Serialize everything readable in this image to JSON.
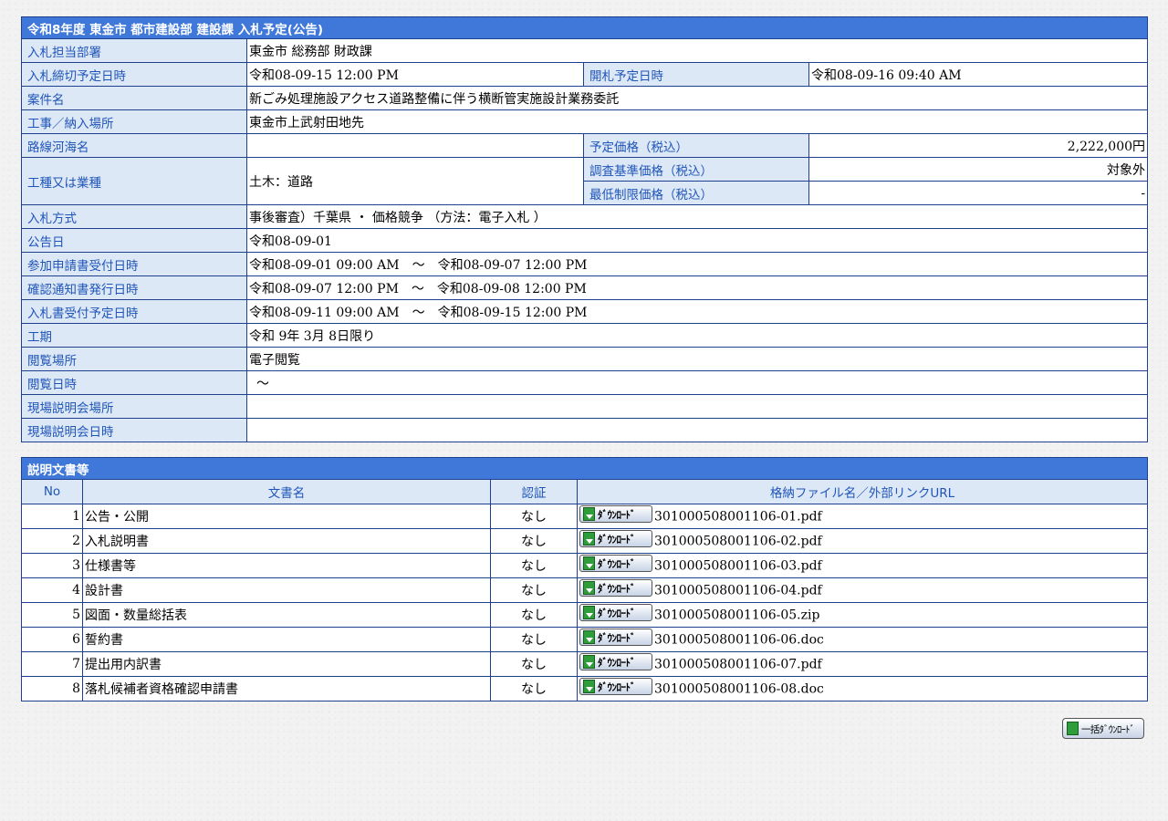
{
  "info": {
    "title": "令和8年度 東金市 都市建設部 建設課 入札予定(公告)",
    "rows": {
      "dept_label": "入札担当部署",
      "dept_value": "東金市 総務部 財政課",
      "deadline_label": "入札締切予定日時",
      "deadline_value": "令和08-09-15 12:00 PM",
      "opening_label": "開札予定日時",
      "opening_value": "令和08-09-16 09:40 AM",
      "case_label": "案件名",
      "case_value": "新ごみ処理施設アクセス道路整備に伴う横断管実施設計業務委託",
      "place_label": "工事／納入場所",
      "place_value": "東金市上武射田地先",
      "route_label": "路線河海名",
      "route_value": "",
      "price_label": "予定価格（税込）",
      "price_value": "2,222,000円",
      "type_label": "工種又は業種",
      "type_value": "土木：道路",
      "survey_label": "調査基準価格（税込）",
      "survey_value": "対象外",
      "min_label": "最低制限価格（税込）",
      "min_value": "-",
      "method_label": "入札方式",
      "method_value": "事後審査）千葉県 ・ 価格競争 （方法：電子入札 ）",
      "notice_label": "公告日",
      "notice_value": "令和08-09-01",
      "apply_label": "参加申請書受付日時",
      "apply_value": "令和08-09-01 09:00 AM　～　令和08-09-07 12:00 PM",
      "confirm_label": "確認通知書発行日時",
      "confirm_value": "令和08-09-07 12:00 PM　～　令和08-09-08 12:00 PM",
      "receipt_label": "入札書受付予定日時",
      "receipt_value": "令和08-09-11 09:00 AM　～　令和08-09-15 12:00 PM",
      "period_label": "工期",
      "period_value": "令和 9年 3月 8日限り",
      "view_place_label": "閲覧場所",
      "view_place_value": "電子閲覧",
      "view_date_label": "閲覧日時",
      "view_date_value": "～",
      "site_place_label": "現場説明会場所",
      "site_place_value": "",
      "site_date_label": "現場説明会日時",
      "site_date_value": ""
    }
  },
  "docs": {
    "title": "説明文書等",
    "headers": [
      "No",
      "文書名",
      "認証",
      "格納ファイル名／外部リンクURL"
    ],
    "download_label": "ﾀﾞｳﾝﾛｰﾄﾞ",
    "rows": [
      {
        "no": "1",
        "name": "公告・公開",
        "auth": "なし",
        "file": "301000508001106-01.pdf"
      },
      {
        "no": "2",
        "name": "入札説明書",
        "auth": "なし",
        "file": "301000508001106-02.pdf"
      },
      {
        "no": "3",
        "name": "仕様書等",
        "auth": "なし",
        "file": "301000508001106-03.pdf"
      },
      {
        "no": "4",
        "name": "設計書",
        "auth": "なし",
        "file": "301000508001106-04.pdf"
      },
      {
        "no": "5",
        "name": "図面・数量総括表",
        "auth": "なし",
        "file": "301000508001106-05.zip"
      },
      {
        "no": "6",
        "name": "誓約書",
        "auth": "なし",
        "file": "301000508001106-06.doc"
      },
      {
        "no": "7",
        "name": "提出用内訳書",
        "auth": "なし",
        "file": "301000508001106-07.pdf"
      },
      {
        "no": "8",
        "name": "落札候補者資格確認申請書",
        "auth": "なし",
        "file": "301000508001106-08.doc"
      }
    ]
  },
  "bulk_download_label": "一括ﾀﾞｳﾝﾛｰﾄﾞ",
  "colors": {
    "header_bg": "#3f78d8",
    "label_bg": "#dde8f7",
    "label_text": "#1f55b8",
    "border": "#1f3f8f"
  }
}
